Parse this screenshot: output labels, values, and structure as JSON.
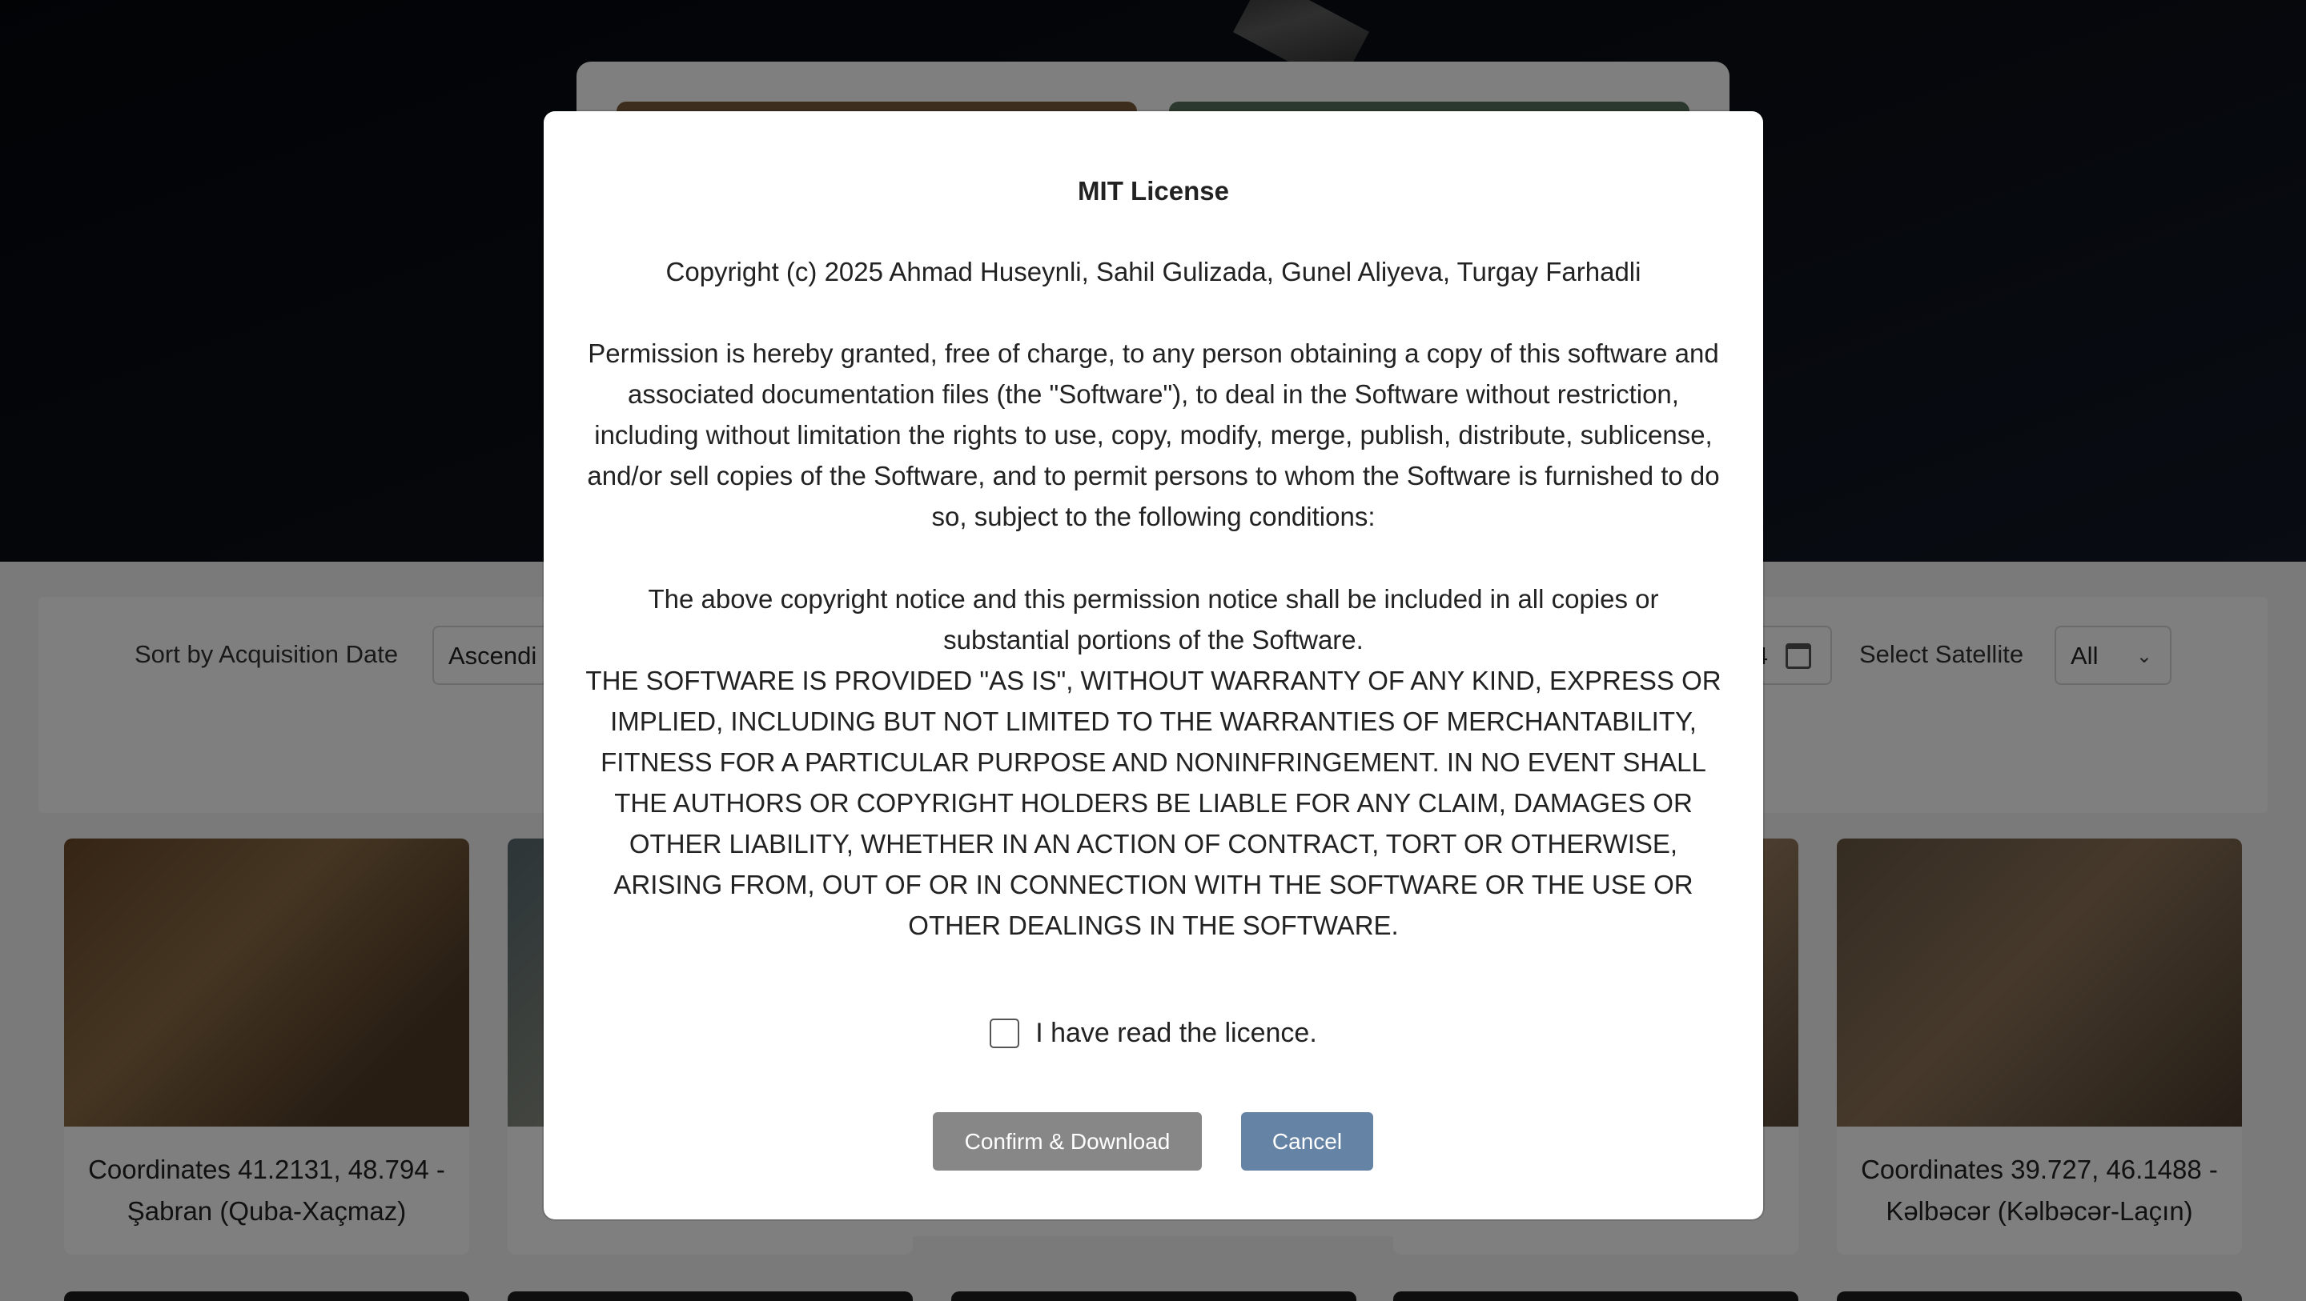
{
  "controls": {
    "sort_label": "Sort by Acquisition Date",
    "sort_value": "Ascendi",
    "date_value_fragment": "4",
    "satellite_label": "Select Satellite",
    "satellite_value": "All"
  },
  "cards": [
    {
      "line1": "Coordinates 41.2131, 48.794 -",
      "line2": "Şabran (Quba-Xaçmaz)"
    },
    {
      "line1": "Coordinates 39.727, 46.1488 -",
      "line2": "Kəlbəcər (Kəlbəcər-Laçın)"
    }
  ],
  "dialog": {
    "title": "MIT License",
    "copyright": "Copyright (c) 2025 Ahmad Huseynli, Sahil Gulizada, Gunel Aliyeva, Turgay Farhadli",
    "permission": "Permission is hereby granted, free of charge, to any person obtaining a copy of this software and associated documentation files (the \"Software\"), to deal in the Software without restriction, including without limitation the rights to use, copy, modify, merge, publish, distribute, sublicense, and/or sell copies of the Software, and to permit persons to whom the Software is furnished to do so, subject to the following conditions:",
    "notice": "The above copyright notice and this permission notice shall be included in all copies or substantial portions of the Software.",
    "warranty": "THE SOFTWARE IS PROVIDED \"AS IS\", WITHOUT WARRANTY OF ANY KIND, EXPRESS OR IMPLIED, INCLUDING BUT NOT LIMITED TO THE WARRANTIES OF MERCHANTABILITY, FITNESS FOR A PARTICULAR PURPOSE AND NONINFRINGEMENT. IN NO EVENT SHALL THE AUTHORS OR COPYRIGHT HOLDERS BE LIABLE FOR ANY CLAIM, DAMAGES OR OTHER LIABILITY, WHETHER IN AN ACTION OF CONTRACT, TORT OR OTHERWISE, ARISING FROM, OUT OF OR IN CONNECTION WITH THE SOFTWARE OR THE USE OR OTHER DEALINGS IN THE SOFTWARE.",
    "checkbox_label": "I have read the licence.",
    "checkbox_checked": false,
    "confirm_label": "Confirm & Download",
    "cancel_label": "Cancel"
  },
  "colors": {
    "confirm_button": "#878787",
    "cancel_button": "#6583a4"
  }
}
